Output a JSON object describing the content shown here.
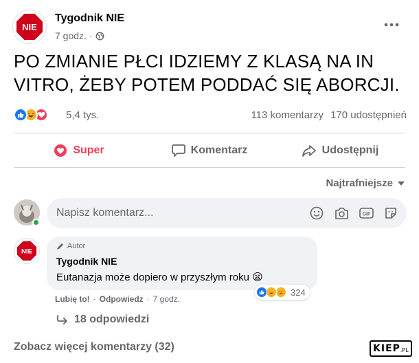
{
  "post": {
    "page_name": "Tygodnik NIE",
    "logo_text": "NIE",
    "time": "7 godz.",
    "separator": "·",
    "text_line1": "PO ZMIANIE PŁCI IDZIEMY Z KLASĄ NA IN",
    "text_line2": "VITRO, ŻEBY POTEM PODDAĆ SIĘ ABORCJI.",
    "reaction_count": "5,4 tys.",
    "comments_count": "113 komentarzy",
    "shares_count": "170 udostępnień",
    "reaction_icons": [
      "like-icon",
      "haha-icon",
      "love-icon"
    ]
  },
  "actions": {
    "love_label": "Super",
    "comment_label": "Komentarz",
    "share_label": "Udostępnij"
  },
  "sort": {
    "label": "Najtrafniejsze"
  },
  "composer": {
    "placeholder": "Napisz komentarz...",
    "tools": [
      "emoji-icon",
      "camera-icon",
      "gif-icon",
      "sticker-icon"
    ]
  },
  "comment": {
    "badge": "Autor",
    "author": "Tygodnik NIE",
    "logo_text": "NIE",
    "text": "Eutanazja może dopiero w przyszłym roku 😦",
    "reaction_count": "324",
    "like_label": "Lubię to!",
    "reply_label": "Odpowiedz",
    "time": "7 godz.",
    "dot": "·"
  },
  "replies": {
    "label": "18 odpowiedzi"
  },
  "more_comments": {
    "label": "Zobacz więcej komentarzy (32)"
  },
  "watermark": {
    "text": "KIEP",
    "suffix": ".PL"
  },
  "colors": {
    "love": "#f33e58",
    "like": "#1877f2",
    "secondary_text": "#65676b",
    "bubble": "#f0f2f5"
  }
}
